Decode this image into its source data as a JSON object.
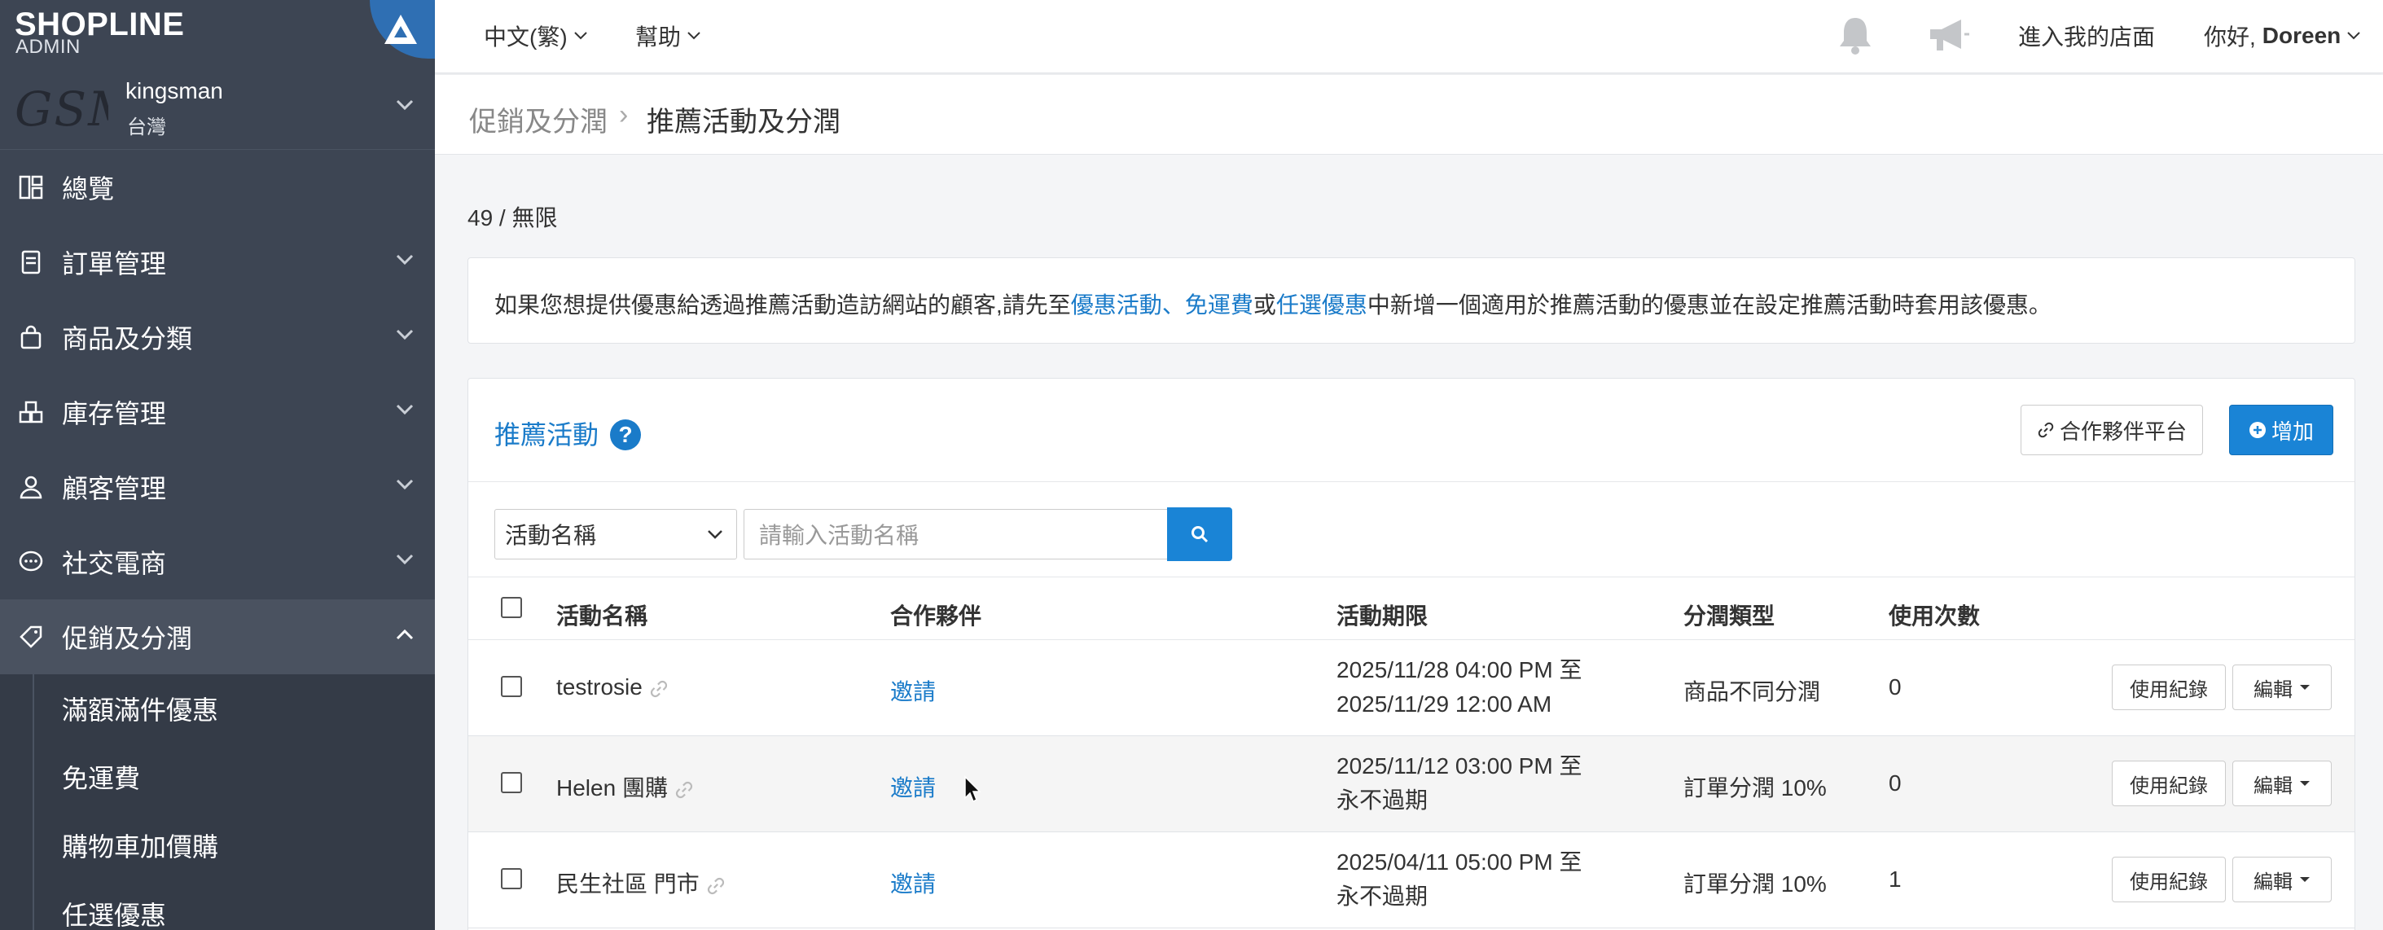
{
  "brand": {
    "logo": "SHOPLINE",
    "admin": "ADMIN"
  },
  "store": {
    "logo_text": "GSM",
    "name": "kingsman",
    "region": "台灣"
  },
  "sidebar": {
    "items": [
      {
        "label": "總覽",
        "icon": "dashboard-icon"
      },
      {
        "label": "訂單管理",
        "icon": "order-icon"
      },
      {
        "label": "商品及分類",
        "icon": "bag-icon"
      },
      {
        "label": "庫存管理",
        "icon": "inventory-icon"
      },
      {
        "label": "顧客管理",
        "icon": "user-icon"
      },
      {
        "label": "社交電商",
        "icon": "chat-icon"
      },
      {
        "label": "促銷及分潤",
        "icon": "tag-icon"
      }
    ],
    "sub_items": [
      "滿額滿件優惠",
      "免運費",
      "購物車加價購",
      "任選優惠"
    ]
  },
  "topbar": {
    "language": "中文(繁)",
    "help": "幫助",
    "enter_store": "進入我的店面",
    "greeting": "你好,",
    "user": "Doreen"
  },
  "breadcrumb": {
    "parent": "促銷及分潤",
    "current": "推薦活動及分潤"
  },
  "usage_count": "49 / 無限",
  "notice": {
    "prefix": "如果您想提供優惠給透過推薦活動造訪網站的顧客,請先至",
    "link1": "優惠活動",
    "sep1": "、",
    "link2": "免運費",
    "sep2": "或",
    "link3": "任選優惠",
    "suffix": "中新增一個適用於推薦活動的優惠並在設定推薦活動時套用該優惠。"
  },
  "panel": {
    "title": "推薦活動",
    "help_symbol": "?",
    "partner_button": "合作夥伴平台",
    "add_button": "增加"
  },
  "filter": {
    "field": "活動名稱",
    "placeholder": "請輸入活動名稱"
  },
  "table": {
    "columns": [
      "活動名稱",
      "合作夥伴",
      "活動期限",
      "分潤類型",
      "使用次數"
    ],
    "rows": [
      {
        "name": "testrosie",
        "partner": "邀請",
        "period_start": "2025/11/28 04:00 PM 至",
        "period_end": "2025/11/29 12:00 AM",
        "type": "商品不同分潤",
        "uses": "0"
      },
      {
        "name": "Helen 團購",
        "partner": "邀請",
        "period_start": "2025/11/12 03:00 PM 至",
        "period_end": "永不過期",
        "type": "訂單分潤 10%",
        "uses": "0"
      },
      {
        "name": "民生社區 門市",
        "partner": "邀請",
        "period_start": "2025/04/11 05:00 PM 至",
        "period_end": "永不過期",
        "type": "訂單分潤 10%",
        "uses": "1"
      }
    ],
    "row_actions": {
      "log": "使用紀錄",
      "edit": "編輯"
    }
  }
}
